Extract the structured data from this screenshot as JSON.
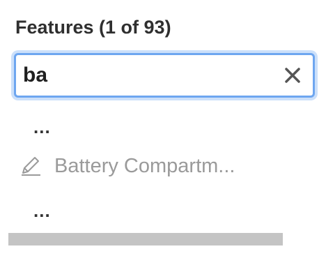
{
  "panel": {
    "title": "Features (1 of 93)"
  },
  "search": {
    "value": "ba",
    "clear_icon": "close-icon",
    "focus_color": "#6ea6f0"
  },
  "list": {
    "ellipsis_top": "...",
    "items": [
      {
        "label": "Battery Compartm...",
        "icon": "pencil-icon",
        "color": "#9a9a9a"
      }
    ],
    "ellipsis_bottom": "..."
  },
  "scrollbar": {
    "color": "#c4c4c4"
  }
}
